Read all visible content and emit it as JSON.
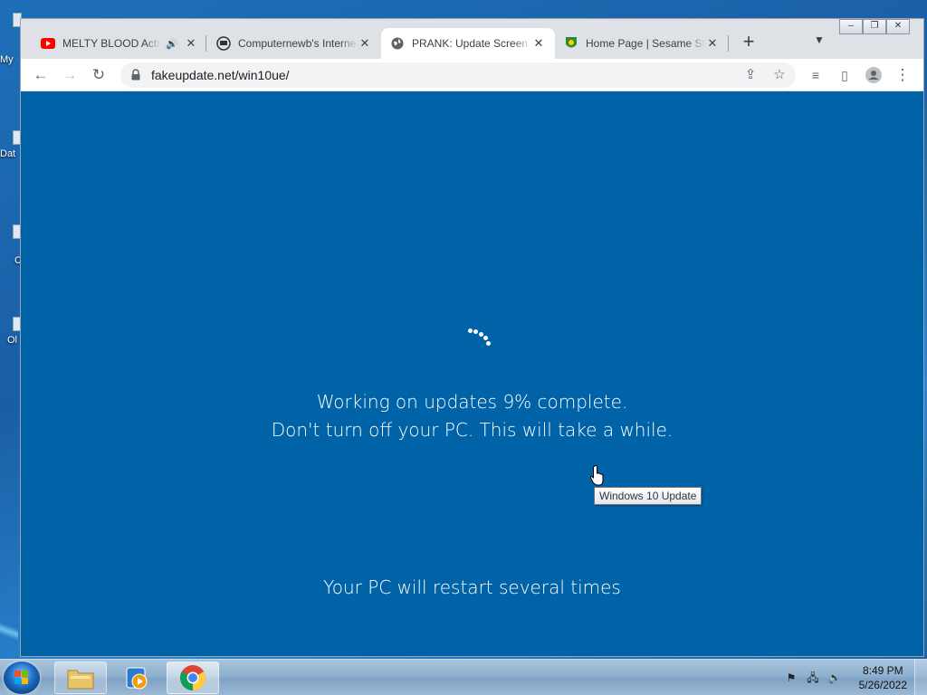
{
  "desktop": {
    "icons": [
      {
        "label": "My",
        "icon": "computer-icon"
      },
      {
        "label": "Dat",
        "icon": "data-icon"
      },
      {
        "label": "C",
        "icon": "app-icon"
      },
      {
        "label": "Ol",
        "icon": "app-icon"
      }
    ]
  },
  "browser": {
    "tabs": [
      {
        "title": "MELTY BLOOD Actress Again",
        "icon": "youtube-icon",
        "audio": true,
        "active": false
      },
      {
        "title": "Computernewb's Internet",
        "icon": "computernewb-icon",
        "audio": false,
        "active": false
      },
      {
        "title": "PRANK: Update Screen",
        "icon": "globe-icon",
        "audio": false,
        "active": true
      },
      {
        "title": "Home Page | Sesame Street",
        "icon": "sesame-icon",
        "audio": false,
        "active": false
      }
    ],
    "new_tab_symbol": "+",
    "address": "fakeupdate.net/win10ue/",
    "window_controls": {
      "minimize": "–",
      "restore": "❐",
      "close": "✕"
    }
  },
  "page": {
    "progress_line": "Working on updates  9% complete.",
    "progress_percent": 9,
    "warning_line": "Don't turn off your PC. This will take a while.",
    "restart_line": "Your PC will restart several times",
    "background_color": "#0063a8"
  },
  "tooltip": {
    "text": "Windows 10 Update"
  },
  "taskbar": {
    "apps": [
      "file-explorer-icon",
      "media-player-icon",
      "chrome-icon"
    ],
    "clock_time": "8:49 PM",
    "clock_date": "5/26/2022",
    "tray_icons": [
      "action-center-flag-icon",
      "network-icon",
      "volume-icon"
    ]
  }
}
